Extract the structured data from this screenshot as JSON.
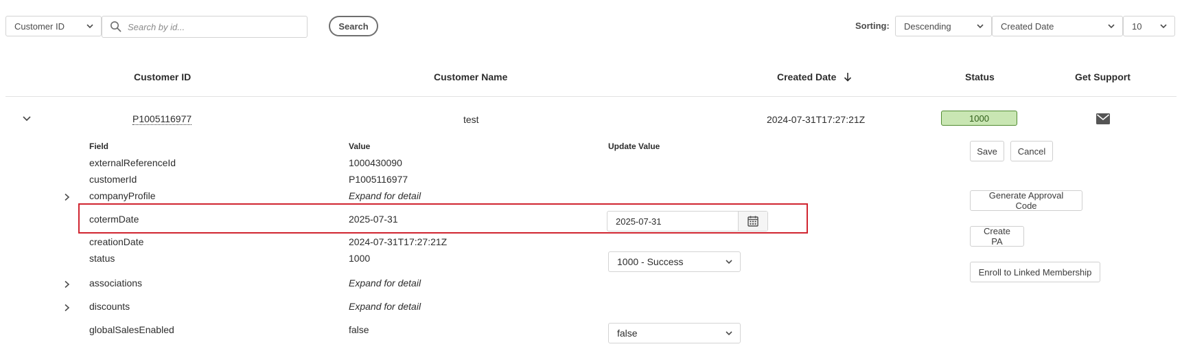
{
  "toolbar": {
    "filter_field": "Customer ID",
    "search_placeholder": "Search by id...",
    "search_button": "Search",
    "sorting_label": "Sorting:",
    "sort_order": "Descending",
    "sort_field": "Created Date",
    "page_size": "10"
  },
  "table": {
    "headers": {
      "customer_id": "Customer ID",
      "customer_name": "Customer Name",
      "created_date": "Created Date",
      "status": "Status",
      "get_support": "Get Support"
    },
    "row": {
      "customer_id": "P1005116977",
      "customer_name": "test",
      "created_date": "2024-07-31T17:27:21Z",
      "status": "1000"
    }
  },
  "detail": {
    "headers": {
      "field": "Field",
      "value": "Value",
      "update_value": "Update Value"
    },
    "fields": [
      {
        "name": "externalReferenceId",
        "value": "1000430090"
      },
      {
        "name": "customerId",
        "value": "P1005116977"
      },
      {
        "name": "companyProfile",
        "value": "Expand for detail"
      },
      {
        "name": "cotermDate",
        "value": "2025-07-31",
        "update_value": "2025-07-31"
      },
      {
        "name": "creationDate",
        "value": "2024-07-31T17:27:21Z"
      },
      {
        "name": "status",
        "value": "1000",
        "update_value": "1000 - Success"
      },
      {
        "name": "associations",
        "value": "Expand for detail"
      },
      {
        "name": "discounts",
        "value": "Expand for detail"
      },
      {
        "name": "globalSalesEnabled",
        "value": "false",
        "update_value": "false"
      }
    ]
  },
  "actions": {
    "save": "Save",
    "cancel": "Cancel",
    "generate_approval_code": "Generate Approval Code",
    "create_pa": "Create PA",
    "enroll_linked_membership": "Enroll to Linked Membership"
  },
  "icons": {
    "search": "search-icon",
    "chevron": "chevron-down-icon",
    "sort_arrow": "arrow-down-icon",
    "mail": "mail-icon",
    "calendar": "calendar-icon",
    "expander": "chevron-right-icon"
  },
  "colors": {
    "highlight": "#d0242f",
    "status_badge_bg": "#c9e6b3",
    "status_badge_border": "#4e8a2f"
  }
}
